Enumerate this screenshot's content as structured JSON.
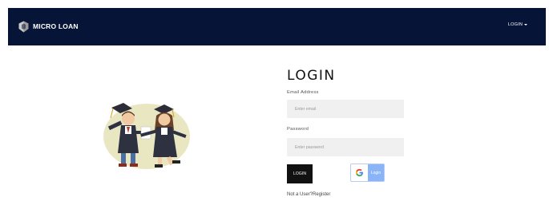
{
  "nav": {
    "brand": "MICRO LOAN",
    "login_menu": "LOGIN"
  },
  "form": {
    "title": "LOGIN",
    "email_label": "Email Address",
    "email_placeholder": "Enter email",
    "password_label": "Password",
    "password_placeholder": "Enter password",
    "login_button": "LOGIN",
    "google_button": "Login",
    "not_user_text": "Not a User?",
    "register_link": "Register"
  },
  "colors": {
    "navbar": "#061537",
    "input_bg": "#f0f0f0",
    "login_button": "#111111",
    "google_accent": "#8ab4f8"
  },
  "icons": {
    "brand": "shield-logo-icon",
    "login_caret": "caret-down-icon",
    "google": "google-g-icon"
  }
}
